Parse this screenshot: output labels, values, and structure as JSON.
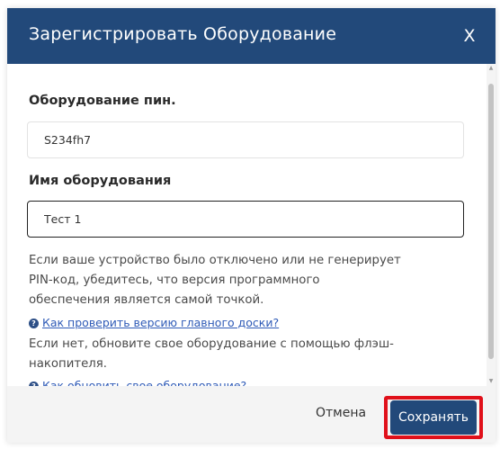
{
  "dialog": {
    "title": "Зарегистрировать Оборудование",
    "close_label": "X"
  },
  "form": {
    "pin_label": "Оборудование пин.",
    "pin_value": "S234fh7",
    "name_label": "Имя оборудования",
    "name_value": "Тест 1"
  },
  "info": {
    "line1": "Если ваше устройство было отключено или не генерирует",
    "line2": "PIN-код, убедитесь, что версия программного",
    "line3": "обеспечения является самой точкой.",
    "help_link_1": "Как проверить версию главного доски?",
    "line4": "Если нет, обновите свое оборудование с помощью флэш-",
    "line5": "накопителя.",
    "help_link_2": "Как обновить свое оборудование?"
  },
  "footer": {
    "cancel_label": "Отмена",
    "save_label": "Сохранять"
  },
  "colors": {
    "header": "#22497a",
    "save_button": "#22497a",
    "highlight": "#e0101a",
    "link": "#2f5bb7"
  },
  "icons": {
    "close": "close-icon",
    "help": "question-circle-icon"
  }
}
